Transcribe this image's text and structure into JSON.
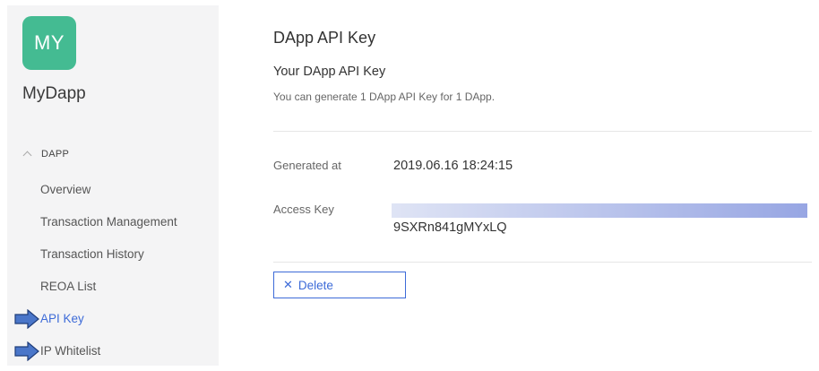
{
  "sidebar": {
    "logo_text": "MY",
    "logo_color": "#44bb92",
    "app_name": "MyDapp",
    "section_header": "DAPP",
    "items": [
      {
        "label": "Overview"
      },
      {
        "label": "Transaction Management"
      },
      {
        "label": "Transaction History"
      },
      {
        "label": "REOA List"
      },
      {
        "label": "API Key",
        "active": true
      },
      {
        "label": "IP Whitelist"
      }
    ]
  },
  "main": {
    "page_title": "DApp API Key",
    "sub_title": "Your DApp API Key",
    "description": "You can generate 1 DApp API Key for 1 DApp.",
    "generated_at_label": "Generated at",
    "generated_at_value": "2019.06.16 18:24:15",
    "access_key_label": "Access Key",
    "access_key_value": "9SXRn841gMYxLQ",
    "delete_label": "Delete"
  },
  "colors": {
    "accent": "#3d6bd8",
    "arrow_fill": "#4a76c9",
    "arrow_stroke": "#1f3d7a"
  }
}
